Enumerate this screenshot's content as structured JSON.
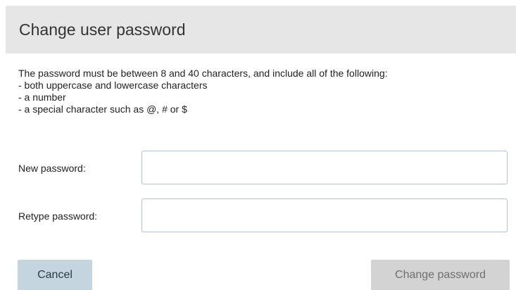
{
  "dialog": {
    "title": "Change user password",
    "instructions": {
      "intro": "The password must be between 8 and 40 characters, and include all of the following:",
      "requirements": [
        "- both uppercase and lowercase characters",
        "- a number",
        "- a special character such as @, # or $"
      ]
    },
    "fields": {
      "new_password": {
        "label": "New password:",
        "value": "",
        "placeholder": ""
      },
      "retype_password": {
        "label": "Retype password:",
        "value": "",
        "placeholder": ""
      }
    },
    "buttons": {
      "cancel_label": "Cancel",
      "change_label": "Change password",
      "change_disabled": true
    },
    "colors": {
      "header_background": "#e6e6e6",
      "cancel_background": "#c5d5e0",
      "change_background_disabled": "#d3d3d3",
      "input_border": "#b5c2cc"
    }
  }
}
